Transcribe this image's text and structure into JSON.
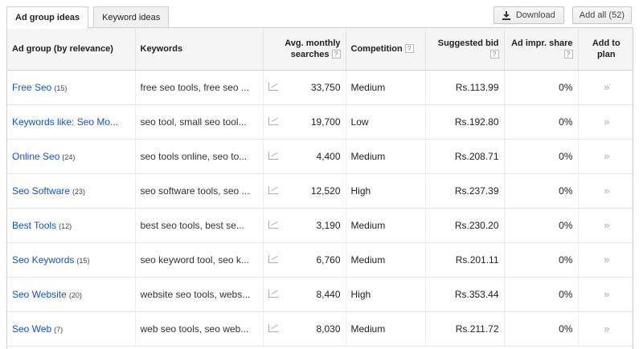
{
  "tabs": [
    {
      "label": "Ad group ideas",
      "active": true
    },
    {
      "label": "Keyword ideas",
      "active": false
    }
  ],
  "actions": {
    "download_label": "Download",
    "add_all_label": "Add all (52)"
  },
  "columns": {
    "ad_group": "Ad group (by relevance)",
    "keywords": "Keywords",
    "avg_searches_line1": "Avg. monthly",
    "avg_searches_line2": "searches",
    "competition": "Competition",
    "suggested_bid": "Suggested bid",
    "ad_impr_share": "Ad impr. share",
    "add_to_plan": "Add to plan",
    "help_glyph": "?"
  },
  "add_glyph": "»",
  "rows": [
    {
      "ad_group": "Free Seo",
      "count": "(15)",
      "keywords": "free seo tools, free seo ...",
      "searches": "33,750",
      "competition": "Medium",
      "bid": "Rs.113.99",
      "share": "0%"
    },
    {
      "ad_group": "Keywords like: Seo Mo...",
      "count": "",
      "keywords": "seo tool, small seo tool...",
      "searches": "19,700",
      "competition": "Low",
      "bid": "Rs.192.80",
      "share": "0%"
    },
    {
      "ad_group": "Online Seo",
      "count": "(24)",
      "keywords": "seo tools online, seo to...",
      "searches": "4,400",
      "competition": "Medium",
      "bid": "Rs.208.71",
      "share": "0%"
    },
    {
      "ad_group": "Seo Software",
      "count": "(23)",
      "keywords": "seo software tools, seo ...",
      "searches": "12,520",
      "competition": "High",
      "bid": "Rs.237.39",
      "share": "0%"
    },
    {
      "ad_group": "Best Tools",
      "count": "(12)",
      "keywords": "best seo tools, best se...",
      "searches": "3,190",
      "competition": "Medium",
      "bid": "Rs.230.20",
      "share": "0%"
    },
    {
      "ad_group": "Seo Keywords",
      "count": "(15)",
      "keywords": "seo keyword tool, seo k...",
      "searches": "6,760",
      "competition": "Medium",
      "bid": "Rs.201.11",
      "share": "0%"
    },
    {
      "ad_group": "Seo Website",
      "count": "(20)",
      "keywords": "website seo tools, webs...",
      "searches": "8,440",
      "competition": "High",
      "bid": "Rs.353.44",
      "share": "0%"
    },
    {
      "ad_group": "Seo Web",
      "count": "(7)",
      "keywords": "web seo tools, seo web...",
      "searches": "8,030",
      "competition": "Medium",
      "bid": "Rs.211.72",
      "share": "0%"
    }
  ]
}
